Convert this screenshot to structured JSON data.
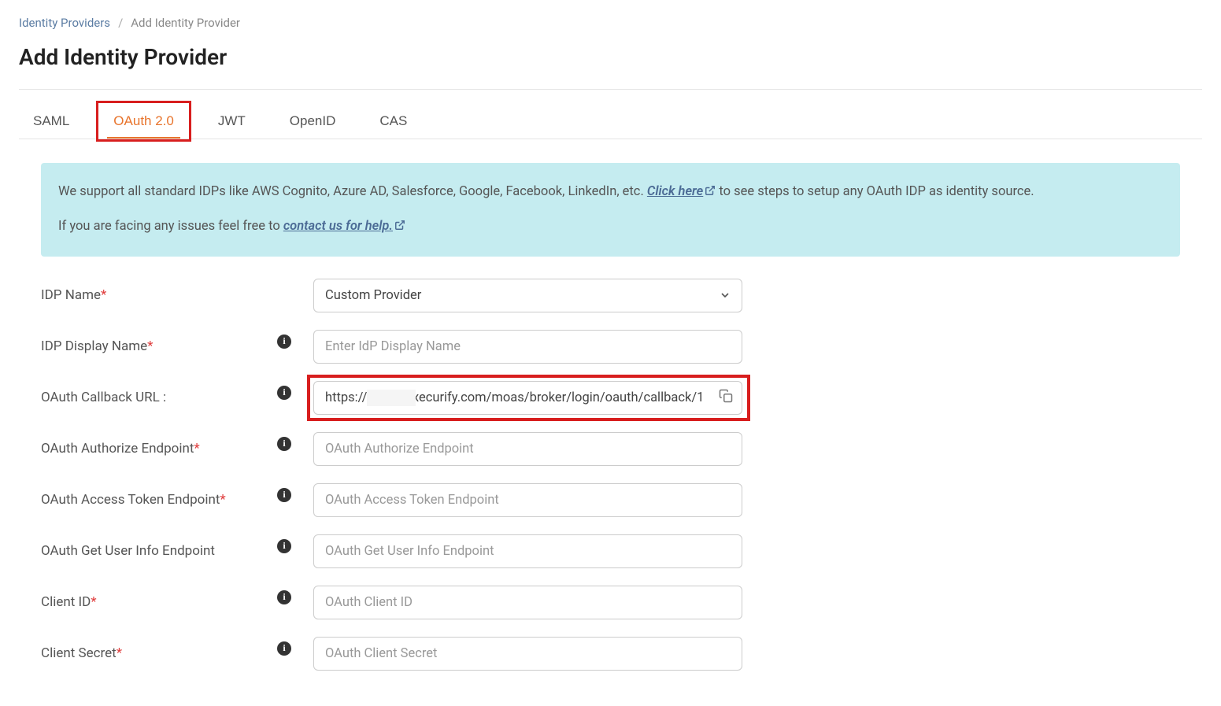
{
  "breadcrumb": {
    "parent": "Identity Providers",
    "separator": "/",
    "current": "Add Identity Provider"
  },
  "page_title": "Add Identity Provider",
  "tabs": [
    {
      "label": "SAML",
      "active": false
    },
    {
      "label": "OAuth 2.0",
      "active": true
    },
    {
      "label": "JWT",
      "active": false
    },
    {
      "label": "OpenID",
      "active": false
    },
    {
      "label": "CAS",
      "active": false
    }
  ],
  "banner": {
    "line1_prefix": "We support all standard IDPs like AWS Cognito, Azure AD, Salesforce, Google, Facebook, LinkedIn, etc. ",
    "line1_link": "Click here",
    "line1_suffix": " to see steps to setup any OAuth IDP as identity source.",
    "line2_prefix": "If you are facing any issues feel free to ",
    "line2_link": "contact us for help."
  },
  "form": {
    "idp_name": {
      "label": "IDP Name",
      "value": "Custom Provider"
    },
    "idp_display_name": {
      "label": "IDP Display Name",
      "placeholder": "Enter IdP Display Name"
    },
    "callback_url": {
      "label": "OAuth Callback URL :",
      "value_display": "https://l            .xecurify.com/moas/broker/login/oauth/callback/1"
    },
    "authorize_endpoint": {
      "label": "OAuth Authorize Endpoint",
      "placeholder": "OAuth Authorize Endpoint"
    },
    "access_token_endpoint": {
      "label": "OAuth Access Token Endpoint",
      "placeholder": "OAuth Access Token Endpoint"
    },
    "user_info_endpoint": {
      "label": "OAuth Get User Info Endpoint",
      "placeholder": "OAuth Get User Info Endpoint"
    },
    "client_id": {
      "label": "Client ID",
      "placeholder": "OAuth Client ID"
    },
    "client_secret": {
      "label": "Client Secret",
      "placeholder": "OAuth Client Secret"
    }
  }
}
